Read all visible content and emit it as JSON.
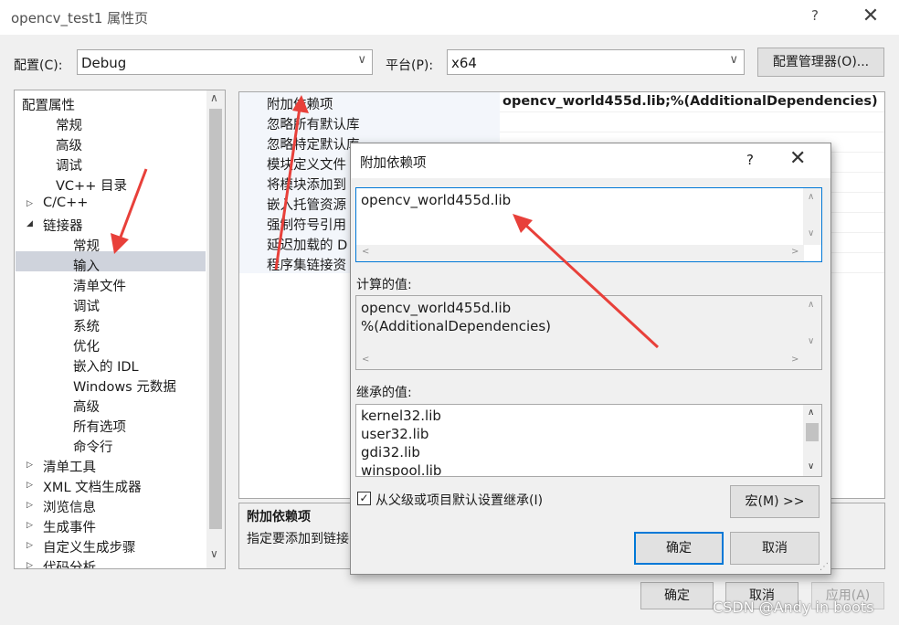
{
  "window": {
    "title": "opencv_test1 属性页",
    "help": "?",
    "close": "✕"
  },
  "config_row": {
    "config_label": "配置(C):",
    "config_value": "Debug",
    "platform_label": "平台(P):",
    "platform_value": "x64",
    "manager_button": "配置管理器(O)..."
  },
  "tree": {
    "items": [
      {
        "label": "配置属性",
        "expander": "◢"
      },
      {
        "label": "常规"
      },
      {
        "label": "高级"
      },
      {
        "label": "调试"
      },
      {
        "label": "VC++ 目录"
      },
      {
        "label": "C/C++",
        "expander": "▷"
      },
      {
        "label": "链接器",
        "expander": "◢"
      },
      {
        "label": "常规"
      },
      {
        "label": "输入"
      },
      {
        "label": "清单文件"
      },
      {
        "label": "调试"
      },
      {
        "label": "系统"
      },
      {
        "label": "优化"
      },
      {
        "label": "嵌入的 IDL"
      },
      {
        "label": "Windows 元数据"
      },
      {
        "label": "高级"
      },
      {
        "label": "所有选项"
      },
      {
        "label": "命令行"
      },
      {
        "label": "清单工具",
        "expander": "▷"
      },
      {
        "label": "XML 文档生成器",
        "expander": "▷"
      },
      {
        "label": "浏览信息",
        "expander": "▷"
      },
      {
        "label": "生成事件",
        "expander": "▷"
      },
      {
        "label": "自定义生成步骤",
        "expander": "▷"
      },
      {
        "label": "代码分析",
        "expander": "▷"
      }
    ],
    "scroll_up": "∧",
    "scroll_down": "∨"
  },
  "grid": {
    "rows": [
      {
        "name": "附加依赖项",
        "value": "opencv_world455d.lib;%(AdditionalDependencies)"
      },
      {
        "name": "忽略所有默认库",
        "value": ""
      },
      {
        "name": "忽略特定默认库",
        "value": ""
      },
      {
        "name": "模块定义文件",
        "value": ""
      },
      {
        "name": "将模块添加到",
        "value": ""
      },
      {
        "name": "嵌入托管资源",
        "value": ""
      },
      {
        "name": "强制符号引用",
        "value": ""
      },
      {
        "name": "延迟加载的 D",
        "value": ""
      },
      {
        "name": "程序集链接资",
        "value": ""
      }
    ],
    "desc_title": "附加依赖项",
    "desc_text": "指定要添加到链接"
  },
  "dialog": {
    "title": "附加依赖项",
    "help": "?",
    "close": "✕",
    "edit_text": "opencv_world455d.lib",
    "computed_label": "计算的值:",
    "computed_lines": [
      "opencv_world455d.lib",
      "%(AdditionalDependencies)"
    ],
    "inherited_label": "继承的值:",
    "inherited_lines": [
      "kernel32.lib",
      "user32.lib",
      "gdi32.lib",
      "winspool.lib"
    ],
    "inherit_checkbox": "从父级或项目默认设置继承(I)",
    "inherit_checked": true,
    "macro_button": "宏(M) >>",
    "ok_button": "确定",
    "cancel_button": "取消"
  },
  "footer": {
    "ok_button": "确定",
    "cancel_button": "取消",
    "apply_button": "应用(A)"
  },
  "watermark": "CSDN @Andy in boots",
  "colors": {
    "accent": "#0078d7",
    "arrow": "#e8403a",
    "selection": "#cfd3dc"
  }
}
